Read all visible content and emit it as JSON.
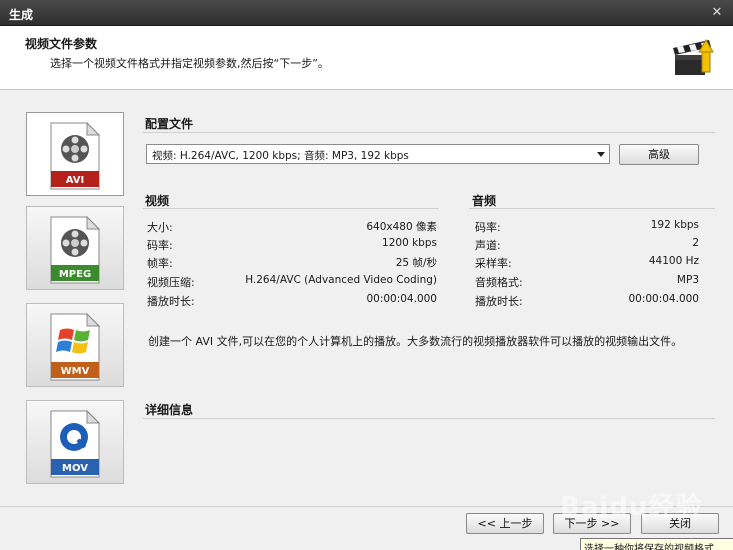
{
  "window": {
    "title": "生成",
    "close_glyph": "✕"
  },
  "header": {
    "title": "视频文件参数",
    "subtitle": "选择一个视频文件格式并指定视频参数,然后按“下一步”。",
    "logo_icon": "clapperboard-icon"
  },
  "formats": [
    {
      "label": "AVI",
      "icon": "film-reel-file-icon",
      "band_color": "#b5221b",
      "selected": true
    },
    {
      "label": "MPEG",
      "icon": "film-reel-file-icon",
      "band_color": "#3b8a2e",
      "selected": false
    },
    {
      "label": "WMV",
      "icon": "windows-logo-file-icon",
      "band_color": "#c0601a",
      "selected": false
    },
    {
      "label": "MOV",
      "icon": "quicktime-logo-file-icon",
      "band_color": "#2a62b0",
      "selected": false
    }
  ],
  "profile": {
    "title": "配置文件",
    "selected": "视频: H.264/AVC, 1200 kbps; 音频: MP3, 192 kbps",
    "advanced_label": "高级"
  },
  "video": {
    "title": "视频",
    "rows": [
      {
        "label": "大小:",
        "value": "640x480 像素"
      },
      {
        "label": "码率:",
        "value": "1200 kbps"
      },
      {
        "label": "帧率:",
        "value": "25 帧/秒"
      },
      {
        "label": "视频压缩:",
        "value": "H.264/AVC (Advanced Video Coding)"
      },
      {
        "label": "播放时长:",
        "value": "00:00:04.000"
      }
    ]
  },
  "audio": {
    "title": "音频",
    "rows": [
      {
        "label": "码率:",
        "value": "192 kbps"
      },
      {
        "label": "声道:",
        "value": "2"
      },
      {
        "label": "采样率:",
        "value": "44100 Hz"
      },
      {
        "label": "音频格式:",
        "value": "MP3"
      },
      {
        "label": "播放时长:",
        "value": "00:00:04.000"
      }
    ]
  },
  "details": {
    "title": "详细信息",
    "text": "创建一个 AVI 文件,可以在您的个人计算机上的播放。大多数流行的视频播放器软件可以播放的视频输出文件。"
  },
  "footer": {
    "back_label": "<< 上一步",
    "next_label": "下一步 >>",
    "close_label": "关闭"
  },
  "tooltip": {
    "text": "选择一种你将保存的视频格式"
  },
  "watermark": {
    "text": "Baidu经验"
  },
  "colors": {
    "titlebar": "#3a3a3a",
    "panel": "#f0f0f0",
    "header": "#ffffff"
  }
}
